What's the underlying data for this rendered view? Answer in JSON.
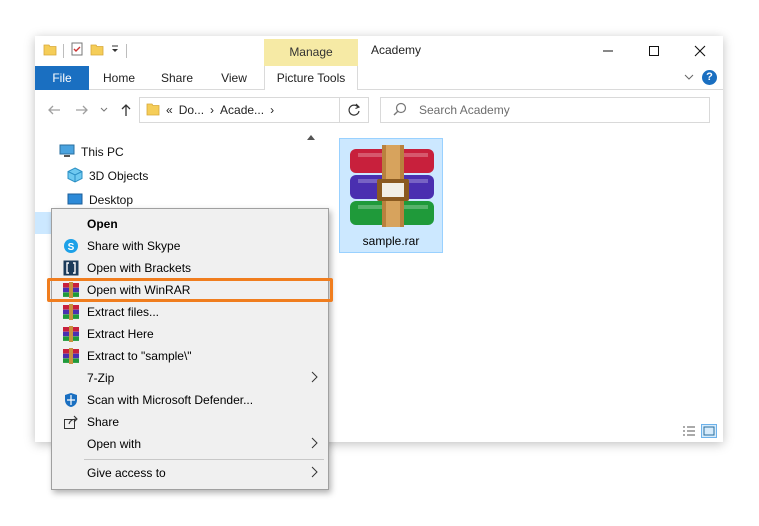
{
  "window": {
    "title": "Academy"
  },
  "ribbon": {
    "manage_tab": "Manage",
    "tabs": [
      "File",
      "Home",
      "Share",
      "View",
      "Picture Tools"
    ]
  },
  "address": {
    "segments": [
      "«",
      "Do...",
      "›",
      "Acade...",
      "›"
    ],
    "search_placeholder": "Search Academy"
  },
  "nav_tree": {
    "items": [
      {
        "label": "This PC",
        "icon": "computer-icon"
      },
      {
        "label": "3D Objects",
        "icon": "cube-icon"
      },
      {
        "label": "Desktop",
        "icon": "desktop-icon"
      }
    ]
  },
  "content": {
    "file": {
      "name": "sample.rar",
      "icon": "winrar-archive-icon"
    }
  },
  "context_menu": {
    "items": [
      {
        "label": "Open",
        "icon": "",
        "bold": true
      },
      {
        "label": "Share with Skype",
        "icon": "skype-icon"
      },
      {
        "label": "Open with Brackets",
        "icon": "brackets-icon"
      },
      {
        "label": "Open with WinRAR",
        "icon": "winrar-icon",
        "highlighted": true
      },
      {
        "label": "Extract files...",
        "icon": "winrar-icon"
      },
      {
        "label": "Extract Here",
        "icon": "winrar-icon"
      },
      {
        "label": "Extract to \"sample\\\"",
        "icon": "winrar-icon"
      },
      {
        "label": "7-Zip",
        "icon": "",
        "submenu": true
      },
      {
        "label": "Scan with Microsoft Defender...",
        "icon": "defender-icon"
      },
      {
        "label": "Share",
        "icon": "share-icon"
      },
      {
        "label": "Open with",
        "icon": "",
        "submenu": true
      },
      {
        "label": "Give access to",
        "icon": "",
        "submenu": true
      }
    ]
  },
  "colors": {
    "accent": "#1a6fc1",
    "highlight": "#f07d1e",
    "manage": "#f6eaa5",
    "selection": "#cce8ff"
  }
}
